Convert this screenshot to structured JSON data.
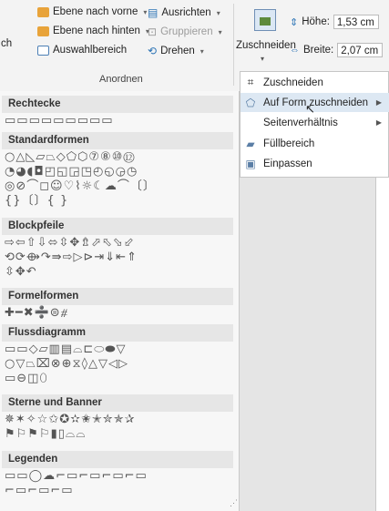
{
  "ribbon": {
    "left_cut": "ch",
    "bring_forward": "Ebene nach vorne",
    "send_backward": "Ebene nach hinten",
    "selection_pane": "Auswahlbereich",
    "align": "Ausrichten",
    "group": "Gruppieren",
    "rotate": "Drehen",
    "arrange_group_label": "Anordnen",
    "crop": "Zuschneiden",
    "height_label": "Höhe:",
    "height_value": "1,53 cm",
    "width_label": "Breite:",
    "width_value": "2,07 cm"
  },
  "shape_sections": [
    {
      "title": "Rechtecke",
      "rows": [
        "▭▭▭▭▭▭▭▭▭"
      ]
    },
    {
      "title": "Standardformen",
      "rows": [
        "○△◺▱⏢◇⬠⬡⑦⑧⑩⑫",
        "◔◕◖◘◰◱◲◳◴◵◶◷",
        "◎⊘⌒◻☺♡⌇☼☾☁⌒〔〕",
        "{}〔〕{ }"
      ]
    },
    {
      "title": "Blockpfeile",
      "rows": [
        "⇨⇦⇧⇩⬄⇳✥⇯⬀⬁⬂⬃",
        "⟲⟳⟴↷⇛⇨▷⊳⇥⇓⇤⇑",
        "⇳✥↶"
      ]
    },
    {
      "title": "Formelformen",
      "rows": [
        "✚━✖➗⊜⧣"
      ]
    },
    {
      "title": "Flussdiagramm",
      "rows": [
        "▭▭◇▱▥▤⌓⊏⬭⬬▽",
        "○▽⏢⌧⊗⊕⧖◊△▽◁▷",
        "▭⊖◫⬯"
      ]
    },
    {
      "title": "Sterne und Banner",
      "rows": [
        "✵✶✧☆✩✪✫✬✭✮✯✰",
        "⚑⚐⚑⚐▮▯⌓⌓"
      ]
    },
    {
      "title": "Legenden",
      "rows": [
        "▭▭◯☁⌐▭⌐▭⌐▭⌐▭",
        "⌐▭⌐▭⌐▭"
      ]
    }
  ],
  "crop_menu": {
    "items": [
      {
        "label": "Zuschneiden",
        "mnemonic_index": 0,
        "icon": "crop-icon",
        "submenu": false
      },
      {
        "label": "Auf Form zuschneiden",
        "mnemonic_index": 14,
        "icon": "crop-to-shape-icon",
        "submenu": true,
        "highlighted": true
      },
      {
        "label": "Seitenverhältnis",
        "mnemonic_index": 3,
        "icon": "",
        "submenu": true
      },
      {
        "label": "Füllbereich",
        "mnemonic_index": 4,
        "icon": "fill-icon",
        "submenu": false
      },
      {
        "label": "Einpassen",
        "mnemonic_index": 0,
        "icon": "fit-icon",
        "submenu": false
      }
    ]
  },
  "colors": {
    "accent": "#2e75b6",
    "orange": "#e8a33a",
    "highlight": "#dde8f3"
  }
}
